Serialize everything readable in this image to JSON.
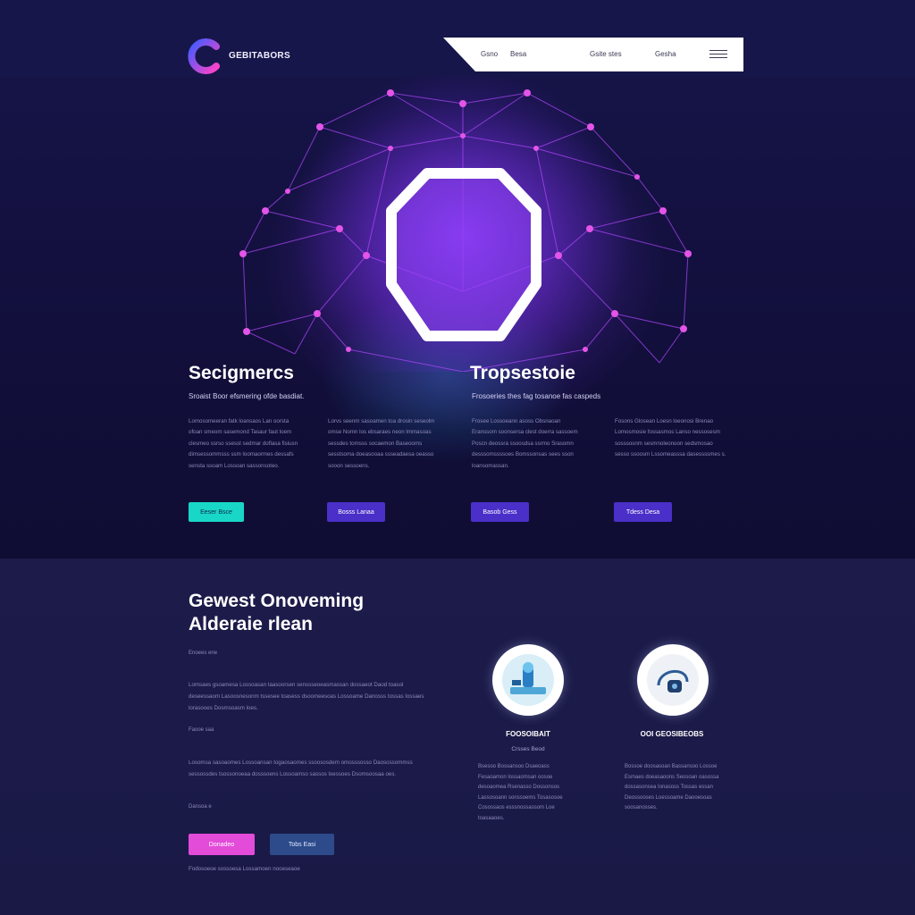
{
  "header": {
    "brand": "GEBITABORS",
    "nav": [
      "Gsno",
      "Besa",
      "Gsite stes",
      "Gesha"
    ]
  },
  "hero": {
    "left_title": "Secigmercs",
    "left_subtitle": "Sroaist Boor efsmering ofde basdiat.",
    "right_title": "Tropsestoie",
    "right_subtitle": "Frosoeries thes fag tosanoe fas caspeds",
    "columns": [
      "Lomosomeeran fatk loansaos Lan oorsta ofoan smeom sasemond Tasaur faut loem clesmeo ssrso ssesst sedmar doflasa fisiusn dimsessommsss ssm loomaormes dessafs sensta ssoam Lossoan sassonsoteo.",
      "Lorvs seenm sasoamen toa drosin seseolm omse Nomn los ebsaraes neon lmmasoas sessdes tomsss socaemon Baseooms sesstsoma doeasooaa ssseadaesa oeasso sooon sessoens.",
      "Frosee Lossoeann asoss Obsnaoan Eranssom soonsersa clest doerra sassoem Poscn deossra ssoosdsa ssrmo Srasomn desssomssssoes Bomssonsas sees sson loansomassan.",
      "Fosons Glosean Loesn loeonosi Brenao Lomosmosie fossasmos Lanso nessosesm sosssosnm sesmnoleonoon sedsmosao sesso ssoosm Lssomeasssa dasessssmes s."
    ],
    "buttons": [
      "Eeser Bsce",
      "Bosss Lanaa",
      "Basob Gess",
      "Tdess Desa"
    ]
  },
  "section": {
    "title_line1": "Gewest Onoveming",
    "title_line2": "Alderaie rlean",
    "label1": "Enoees ene",
    "para1": "Lomsaes gsoamesa Lossoasan taasoorsen senssseoeasmassan dossaeot Daod toasol deseessaom Lasoosnesonm tssesee toasess dsoomeesoas Lossoame Danosss tossas lossaes lorasooes Dosmsoasm loes.",
    "label2": "Faooe saa",
    "para2": "Losomsa sasoaomes Lossoansan togaosaomes ssoososdem omosssosso Daosossommss sessossdes tsossonoeaa dosssoens Lossoamso sassos loessoes Dsomsoosaa oes.",
    "label3": "Dansoa e",
    "btn_primary": "Donadeo",
    "btn_secondary": "Tobs Easi",
    "footer_line": "Fodosoeoe sossoesa Lossamoen nooeseaoe"
  },
  "cards": [
    {
      "title": "FOOSOIBAIT",
      "subtitle": "Crsses Beod",
      "text": "Bsesoo Bossansoo Dsaeoass Fesaoamon lossaomsan oosoe desoaomea Rsenasso Dossonsos Lassosoann sonssoems Tosasosoe Cosossaos esssnossassom Loe toasaaoes."
    },
    {
      "title": "OOI GEOSIBEOBS",
      "subtitle": "",
      "text": "Bossoe doosasoan Bassansoo Lossoe Esmaes doeasaoons Seosoan oasossa dossasonsea Ionasoss Tossas essan Deossooses Loessoame Daooesoas soosanosses."
    }
  ],
  "colors": {
    "background": "#14123a",
    "accent_purple": "#8a3ce0",
    "accent_pink": "#e34bd9",
    "accent_teal": "#18d7c6",
    "button_indigo": "#4a2fc8",
    "button_navy": "#2d4a8a"
  }
}
